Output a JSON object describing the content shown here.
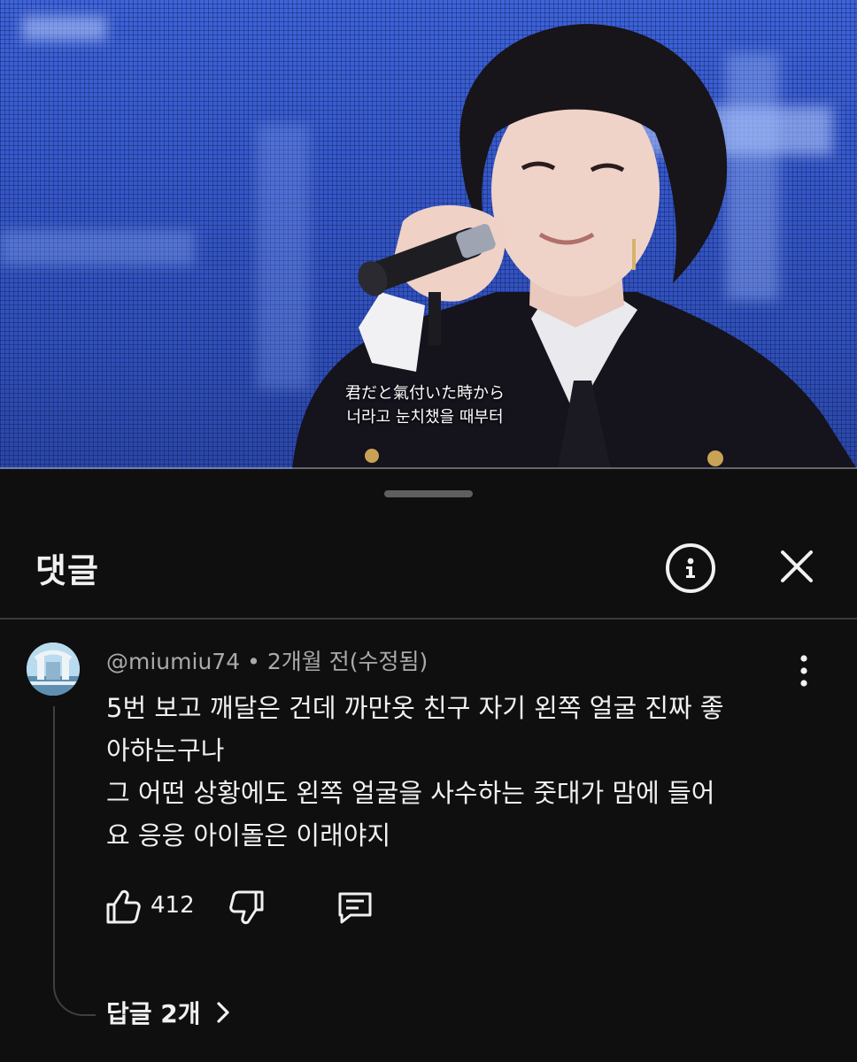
{
  "video": {
    "subtitle_line1": "君だと氣付いた時から",
    "subtitle_line2": "너라고 눈치챘을 때부터"
  },
  "sheet": {
    "title": "댓글",
    "info_icon": "info-icon",
    "close_icon": "close-icon"
  },
  "comment": {
    "author": "@miumiu74",
    "separator": "•",
    "time": "2개월 전(수정됨)",
    "lines": [
      "5번 보고 깨달은 건데 까만옷 친구 자기 왼쪽 얼굴 진짜 좋",
      "아하는구나",
      "그 어떤 상황에도 왼쪽 얼굴을 사수하는 줏대가 맘에 들어",
      "요 응응 아이돌은 이래야지"
    ],
    "like_count": "412",
    "replies_label": "답글 2개"
  },
  "colors": {
    "background": "#0f0f0f",
    "text_primary": "#f1f1f1",
    "text_secondary": "#aaaaaa",
    "video_blue": "#3557c8"
  }
}
